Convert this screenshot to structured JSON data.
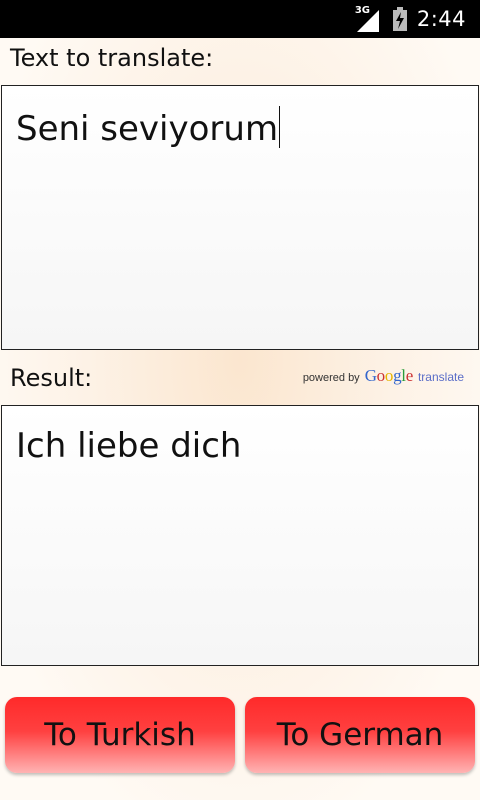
{
  "status_bar": {
    "network_type": "3G",
    "time": "2:44",
    "icons": [
      "signal-icon",
      "battery-charging-icon"
    ]
  },
  "source": {
    "label": "Text to translate:",
    "text": "Seni seviyorum"
  },
  "result": {
    "label": "Result:",
    "text": "Ich liebe dich"
  },
  "attribution": {
    "powered_by": "powered by",
    "google_letters": [
      "G",
      "o",
      "o",
      "g",
      "l",
      "e"
    ],
    "google_colors": [
      "#3366cc",
      "#cc3333",
      "#e8b400",
      "#3366cc",
      "#2a9d3a",
      "#cc3333"
    ],
    "translate": "translate"
  },
  "buttons": {
    "to_turkish": "To Turkish",
    "to_german": "To German"
  },
  "colors": {
    "button_red": "#ff2a2a",
    "status_bar": "#000000"
  }
}
